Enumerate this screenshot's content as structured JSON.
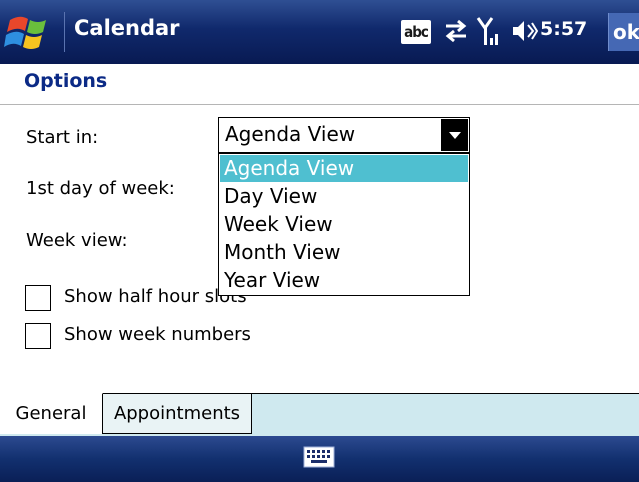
{
  "titlebar": {
    "app_title": "Calendar",
    "input_indicator": "abc",
    "clock": "5:57",
    "ok_label": "ok"
  },
  "page": {
    "heading": "Options"
  },
  "form": {
    "start_in_label": "Start in:",
    "start_in_value": "Agenda View",
    "first_day_label": "1st day of week:",
    "week_view_label": "Week view:",
    "half_hour_label": "Show half hour slots",
    "half_hour_checked": false,
    "week_numbers_label": "Show week numbers",
    "week_numbers_checked": false
  },
  "dropdown": {
    "options": [
      "Agenda View",
      "Day View",
      "Week View",
      "Month View",
      "Year View"
    ],
    "selected_index": 0
  },
  "tabs": [
    {
      "label": "General",
      "active": true
    },
    {
      "label": "Appointments",
      "active": false
    }
  ],
  "icons": {
    "start": "windows-flag-icon",
    "connectivity": "connection-arrows-icon",
    "signal": "signal-strength-icon",
    "volume": "speaker-icon",
    "keyboard": "keyboard-icon"
  },
  "colors": {
    "titlebar": "#10296c",
    "heading": "#0b2a86",
    "selection": "#4fbfd0",
    "tabbar": "#cfe9ef"
  }
}
